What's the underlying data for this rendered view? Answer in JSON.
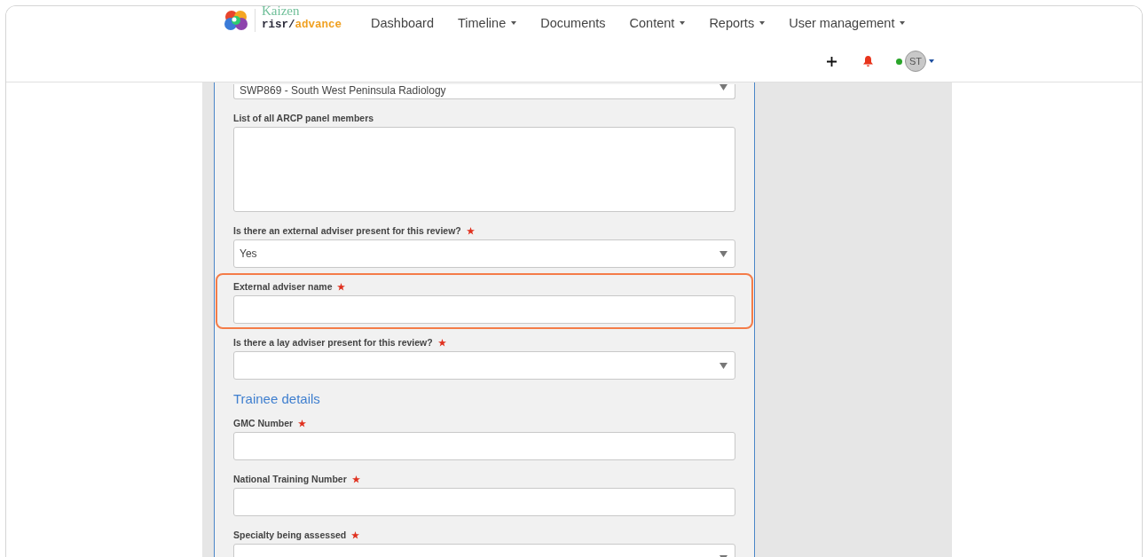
{
  "logo": {
    "top": "Kaizen",
    "brand": "risr/",
    "product": "advance"
  },
  "nav": [
    {
      "label": "Dashboard",
      "dropdown": false
    },
    {
      "label": "Timeline",
      "dropdown": true
    },
    {
      "label": "Documents",
      "dropdown": false
    },
    {
      "label": "Content",
      "dropdown": true
    },
    {
      "label": "Reports",
      "dropdown": true
    },
    {
      "label": "User management",
      "dropdown": true
    }
  ],
  "user": {
    "initials": "ST",
    "online": true
  },
  "form": [
    {
      "kind": "select",
      "value": "SWP869 - South West Peninsula Radiology",
      "required": false,
      "highlighted": false
    },
    {
      "kind": "textarea",
      "label": "List of all ARCP panel members",
      "required": false,
      "highlighted": false
    },
    {
      "kind": "select",
      "label": "Is there an external adviser present for this review?",
      "value": "Yes",
      "required": true,
      "highlighted": false
    },
    {
      "kind": "text",
      "label": "External adviser name",
      "required": true,
      "highlighted": true
    },
    {
      "kind": "select",
      "label": "Is there a lay adviser present for this review?",
      "required": true,
      "highlighted": false
    },
    {
      "kind": "heading",
      "label": "Trainee details"
    },
    {
      "kind": "text",
      "label": "GMC Number",
      "required": true,
      "highlighted": false
    },
    {
      "kind": "text",
      "label": "National Training Number",
      "required": true,
      "highlighted": false
    },
    {
      "kind": "select",
      "label": "Specialty being assessed",
      "required": true,
      "highlighted": false
    }
  ]
}
